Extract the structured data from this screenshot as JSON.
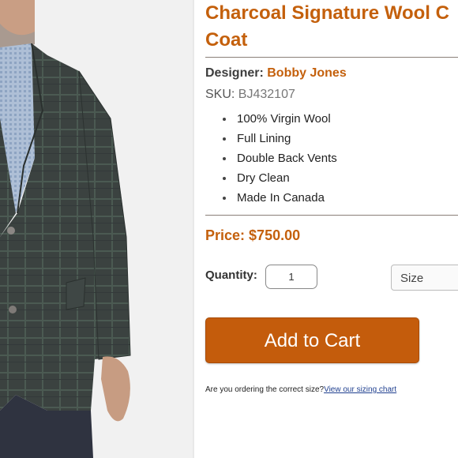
{
  "product": {
    "title": "Charcoal Signature Wool C Coat",
    "designer_label": "Designer:",
    "designer_name": "Bobby Jones",
    "sku_label": "SKU:",
    "sku_value": "BJ432107",
    "features": [
      "100% Virgin Wool",
      "Full Lining",
      "Double Back Vents",
      "Dry Clean",
      "Made In Canada"
    ],
    "price_label": "Price:",
    "price_value": "$750.00"
  },
  "purchase": {
    "quantity_label": "Quantity:",
    "quantity_value": "1",
    "size_selected": "Size",
    "add_to_cart_label": "Add to Cart"
  },
  "sizing": {
    "question": "Are you ordering the correct size?",
    "link_text": "View our sizing chart"
  },
  "colors": {
    "accent": "#c4600c",
    "button": "#c45c0c",
    "link": "#1f3f8f"
  }
}
